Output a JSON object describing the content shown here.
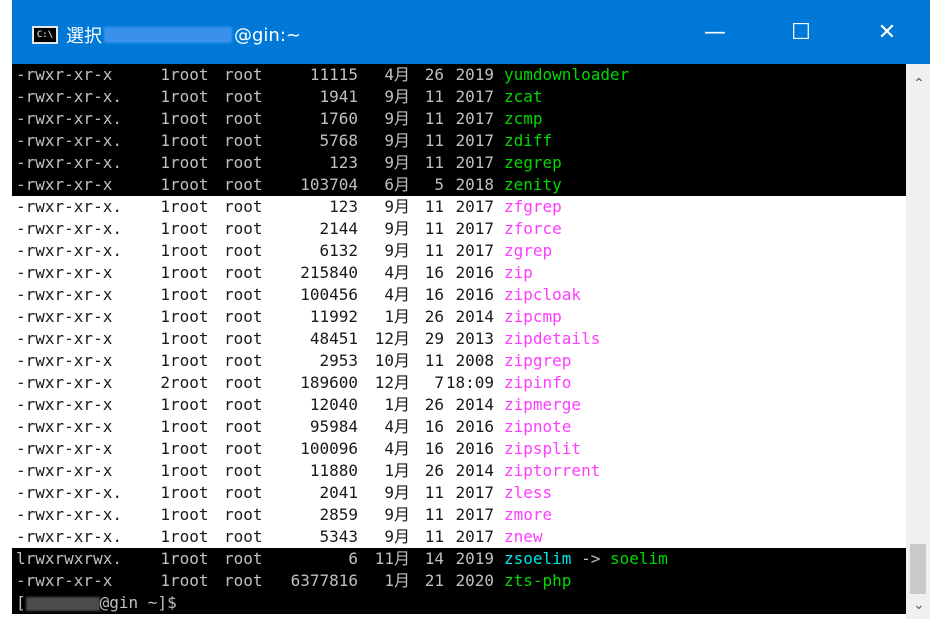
{
  "titlebar": {
    "icon_text": "C:\\",
    "prefix": "選択",
    "host": "@gin:~",
    "minimize": "—",
    "maximize": "☐",
    "close": "✕"
  },
  "terminal": {
    "rows": [
      {
        "perm": "-rwxr-xr-x",
        "links": "1",
        "owner": "root",
        "group": "root",
        "size": "11115",
        "month": "4月",
        "day": "26",
        "year": "2019",
        "name": "yumdownloader",
        "name_color": "green",
        "bg": "black"
      },
      {
        "perm": "-rwxr-xr-x.",
        "links": "1",
        "owner": "root",
        "group": "root",
        "size": "1941",
        "month": "9月",
        "day": "11",
        "year": "2017",
        "name": "zcat",
        "name_color": "green",
        "bg": "black"
      },
      {
        "perm": "-rwxr-xr-x.",
        "links": "1",
        "owner": "root",
        "group": "root",
        "size": "1760",
        "month": "9月",
        "day": "11",
        "year": "2017",
        "name": "zcmp",
        "name_color": "green",
        "bg": "black"
      },
      {
        "perm": "-rwxr-xr-x.",
        "links": "1",
        "owner": "root",
        "group": "root",
        "size": "5768",
        "month": "9月",
        "day": "11",
        "year": "2017",
        "name": "zdiff",
        "name_color": "green",
        "bg": "black"
      },
      {
        "perm": "-rwxr-xr-x.",
        "links": "1",
        "owner": "root",
        "group": "root",
        "size": "123",
        "month": "9月",
        "day": "11",
        "year": "2017",
        "name": "zegrep",
        "name_color": "green",
        "bg": "black"
      },
      {
        "perm": "-rwxr-xr-x",
        "links": "1",
        "owner": "root",
        "group": "root",
        "size": "103704",
        "month": "6月",
        "day": "5",
        "year": "2018",
        "name": "zenity",
        "name_color": "green",
        "bg": "black"
      },
      {
        "perm": "-rwxr-xr-x.",
        "links": "1",
        "owner": "root",
        "group": "root",
        "size": "123",
        "month": "9月",
        "day": "11",
        "year": "2017",
        "name": "zfgrep",
        "name_color": "magenta",
        "bg": "white"
      },
      {
        "perm": "-rwxr-xr-x.",
        "links": "1",
        "owner": "root",
        "group": "root",
        "size": "2144",
        "month": "9月",
        "day": "11",
        "year": "2017",
        "name": "zforce",
        "name_color": "magenta",
        "bg": "white"
      },
      {
        "perm": "-rwxr-xr-x.",
        "links": "1",
        "owner": "root",
        "group": "root",
        "size": "6132",
        "month": "9月",
        "day": "11",
        "year": "2017",
        "name": "zgrep",
        "name_color": "magenta",
        "bg": "white"
      },
      {
        "perm": "-rwxr-xr-x",
        "links": "1",
        "owner": "root",
        "group": "root",
        "size": "215840",
        "month": "4月",
        "day": "16",
        "year": "2016",
        "name": "zip",
        "name_color": "magenta",
        "bg": "white"
      },
      {
        "perm": "-rwxr-xr-x",
        "links": "1",
        "owner": "root",
        "group": "root",
        "size": "100456",
        "month": "4月",
        "day": "16",
        "year": "2016",
        "name": "zipcloak",
        "name_color": "magenta",
        "bg": "white"
      },
      {
        "perm": "-rwxr-xr-x",
        "links": "1",
        "owner": "root",
        "group": "root",
        "size": "11992",
        "month": "1月",
        "day": "26",
        "year": "2014",
        "name": "zipcmp",
        "name_color": "magenta",
        "bg": "white"
      },
      {
        "perm": "-rwxr-xr-x",
        "links": "1",
        "owner": "root",
        "group": "root",
        "size": "48451",
        "month": "12月",
        "day": "29",
        "year": "2013",
        "name": "zipdetails",
        "name_color": "magenta",
        "bg": "white"
      },
      {
        "perm": "-rwxr-xr-x",
        "links": "1",
        "owner": "root",
        "group": "root",
        "size": "2953",
        "month": "10月",
        "day": "11",
        "year": "2008",
        "name": "zipgrep",
        "name_color": "magenta",
        "bg": "white"
      },
      {
        "perm": "-rwxr-xr-x",
        "links": "2",
        "owner": "root",
        "group": "root",
        "size": "189600",
        "month": "12月",
        "day": "7",
        "year": "18:09",
        "name": "zipinfo",
        "name_color": "magenta",
        "bg": "white"
      },
      {
        "perm": "-rwxr-xr-x",
        "links": "1",
        "owner": "root",
        "group": "root",
        "size": "12040",
        "month": "1月",
        "day": "26",
        "year": "2014",
        "name": "zipmerge",
        "name_color": "magenta",
        "bg": "white"
      },
      {
        "perm": "-rwxr-xr-x",
        "links": "1",
        "owner": "root",
        "group": "root",
        "size": "95984",
        "month": "4月",
        "day": "16",
        "year": "2016",
        "name": "zipnote",
        "name_color": "magenta",
        "bg": "white"
      },
      {
        "perm": "-rwxr-xr-x",
        "links": "1",
        "owner": "root",
        "group": "root",
        "size": "100096",
        "month": "4月",
        "day": "16",
        "year": "2016",
        "name": "zipsplit",
        "name_color": "magenta",
        "bg": "white"
      },
      {
        "perm": "-rwxr-xr-x",
        "links": "1",
        "owner": "root",
        "group": "root",
        "size": "11880",
        "month": "1月",
        "day": "26",
        "year": "2014",
        "name": "ziptorrent",
        "name_color": "magenta",
        "bg": "white"
      },
      {
        "perm": "-rwxr-xr-x.",
        "links": "1",
        "owner": "root",
        "group": "root",
        "size": "2041",
        "month": "9月",
        "day": "11",
        "year": "2017",
        "name": "zless",
        "name_color": "magenta",
        "bg": "white"
      },
      {
        "perm": "-rwxr-xr-x.",
        "links": "1",
        "owner": "root",
        "group": "root",
        "size": "2859",
        "month": "9月",
        "day": "11",
        "year": "2017",
        "name": "zmore",
        "name_color": "magenta",
        "bg": "white"
      },
      {
        "perm": "-rwxr-xr-x.",
        "links": "1",
        "owner": "root",
        "group": "root",
        "size": "5343",
        "month": "9月",
        "day": "11",
        "year": "2017",
        "name": "znew",
        "name_color": "magenta",
        "bg": "white"
      },
      {
        "perm": "lrwxrwxrwx.",
        "links": "1",
        "owner": "root",
        "group": "root",
        "size": "6",
        "month": "11月",
        "day": "14",
        "year": "2019",
        "name": "zsoelim",
        "link_target": "soelim",
        "name_color": "cyan",
        "bg": "black"
      },
      {
        "perm": "-rwxr-xr-x",
        "links": "1",
        "owner": "root",
        "group": "root",
        "size": "6377816",
        "month": "1月",
        "day": "21",
        "year": "2020",
        "name": "zts-php",
        "name_color": "green",
        "bg": "black"
      }
    ],
    "prompt": {
      "open": "[",
      "host": "@gin ~]$"
    }
  },
  "colors": {
    "titlebar": "#0078d7",
    "terminal_black": "#000000",
    "terminal_white": "#ffffff",
    "green": "#00d800",
    "magenta": "#ff3cff",
    "cyan": "#00e6e6"
  }
}
